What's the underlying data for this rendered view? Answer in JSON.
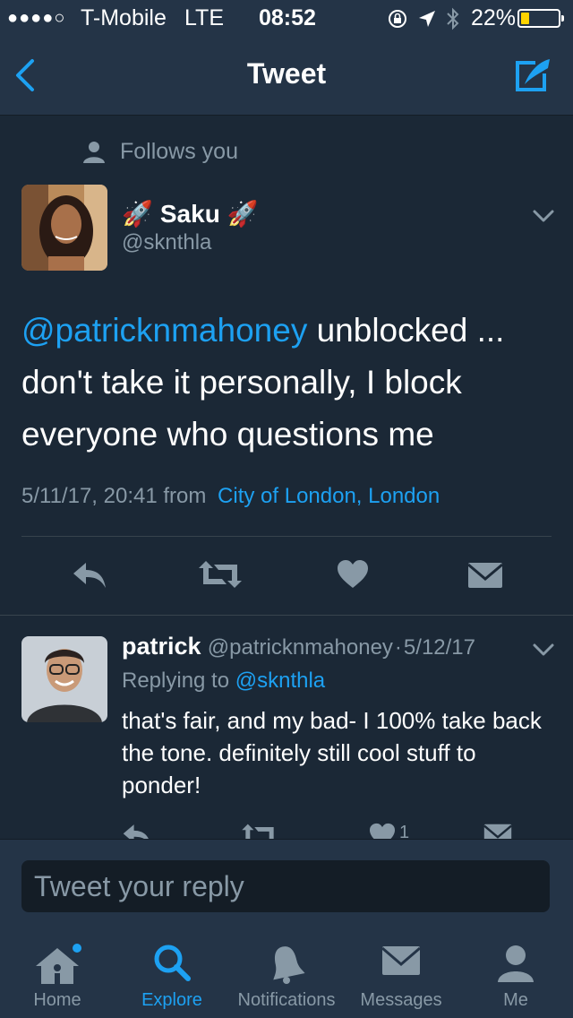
{
  "status_bar": {
    "signal": "●●●●○",
    "carrier": "T-Mobile",
    "network": "LTE",
    "time": "08:52",
    "battery": "22%",
    "battery_level": 0.22,
    "battery_color": "#ffd400"
  },
  "nav": {
    "title": "Tweet",
    "back_icon": "chevron-left-icon",
    "compose_icon": "compose-quill-icon"
  },
  "tweet": {
    "follows_label": "Follows you",
    "rocket_left": "🚀",
    "display_name": "Saku",
    "rocket_right": "🚀",
    "handle": "@sknthla",
    "mention": "@patricknmahoney",
    "text": " unblocked ... don't take it personally, I block everyone who questions me",
    "timestamp": "5/11/17, 20:41",
    "from_label": "from",
    "location": "City of London, London"
  },
  "reply": {
    "display_name": "patrick",
    "handle": "@patricknmahoney",
    "separator": "·",
    "date": "5/12/17",
    "replying_label": "Replying to",
    "replying_handle": "@sknthla",
    "text": "that's fair, and my bad- I 100% take back the tone. definitely still cool stuff to ponder!",
    "like_count": "1"
  },
  "composer": {
    "placeholder": "Tweet your reply"
  },
  "tabs": [
    {
      "label": "Home",
      "icon": "home-icon",
      "active": false
    },
    {
      "label": "Explore",
      "icon": "search-icon",
      "active": true
    },
    {
      "label": "Notifications",
      "icon": "bell-icon",
      "active": false
    },
    {
      "label": "Messages",
      "icon": "envelope-icon",
      "active": false
    },
    {
      "label": "Me",
      "icon": "person-icon",
      "active": false
    }
  ],
  "colors": {
    "background": "#1b2836",
    "bar": "#243447",
    "accent": "#1da1f2",
    "muted": "#8899a6",
    "icon": "#8899a6"
  }
}
